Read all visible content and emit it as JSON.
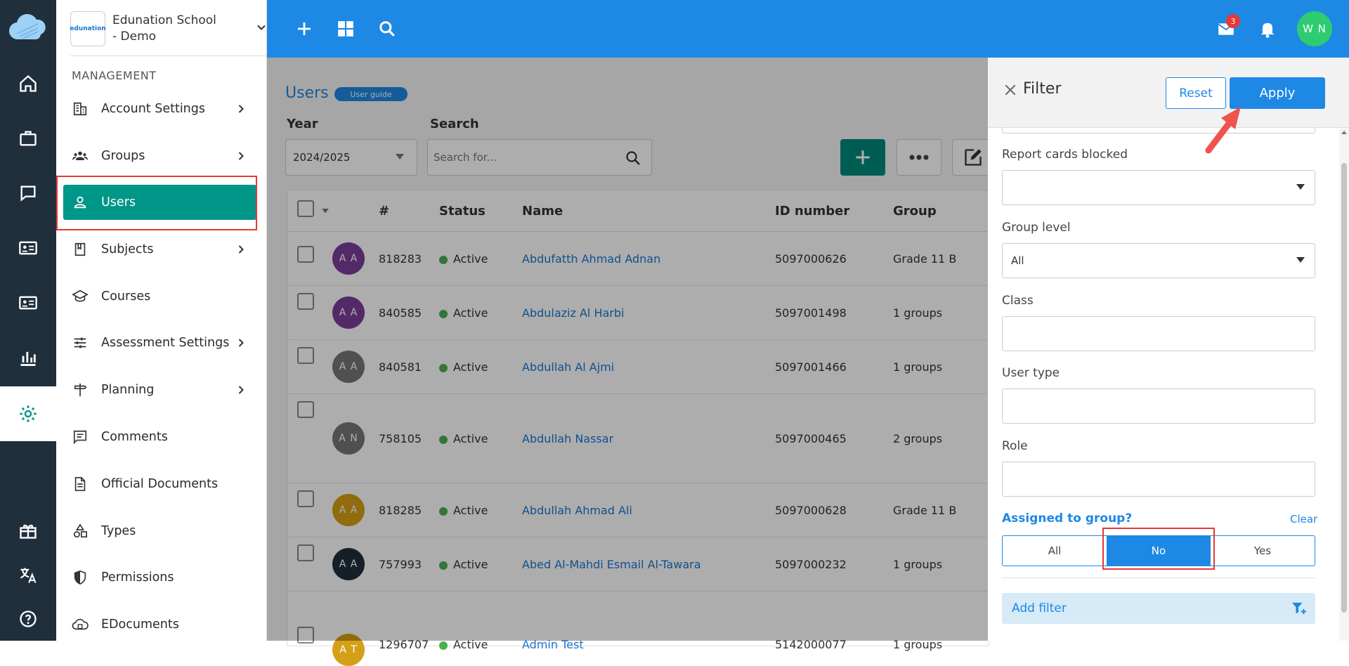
{
  "school": {
    "name": "Edunation School - Demo",
    "logo_text": "edunation"
  },
  "sidebar": {
    "section": "MANAGEMENT",
    "items": [
      {
        "label": "Account Settings"
      },
      {
        "label": "Groups"
      },
      {
        "label": "Users"
      },
      {
        "label": "Subjects"
      },
      {
        "label": "Courses"
      },
      {
        "label": "Assessment Settings"
      },
      {
        "label": "Planning"
      },
      {
        "label": "Comments"
      },
      {
        "label": "Official Documents"
      },
      {
        "label": "Types"
      },
      {
        "label": "Permissions"
      },
      {
        "label": "EDocuments"
      }
    ]
  },
  "topbar": {
    "mail_badge": "3",
    "user_initials": "W N"
  },
  "main": {
    "title": "Users",
    "guide": "User guide",
    "year_label": "Year",
    "year_value": "2024/2025",
    "search_label": "Search",
    "search_placeholder": "Search for..."
  },
  "table": {
    "headers": {
      "num": "#",
      "status": "Status",
      "name": "Name",
      "id": "ID number",
      "group": "Group"
    },
    "rows": [
      {
        "initials": "A A",
        "num": "818283",
        "status": "Active",
        "name": "Abdufatth Ahmad Adnan",
        "id": "5097000626",
        "group": "Grade 11 B",
        "color": "#7b3f98"
      },
      {
        "initials": "A A",
        "num": "840585",
        "status": "Active",
        "name": "Abdulaziz Al Harbi",
        "id": "5097001498",
        "group": "1 groups",
        "color": "#7b3f98"
      },
      {
        "initials": "A A",
        "num": "840581",
        "status": "Active",
        "name": "Abdullah Al Ajmi",
        "id": "5097001466",
        "group": "1 groups",
        "color": "#777"
      },
      {
        "initials": "A N",
        "num": "758105",
        "status": "Active",
        "name": "Abdullah Nassar",
        "id": "5097000465",
        "group": "2 groups",
        "color": "#777"
      },
      {
        "initials": "A A",
        "num": "818285",
        "status": "Active",
        "name": "Abdullah Ahmad Ali",
        "id": "5097000628",
        "group": "Grade 11 B",
        "color": "#d4a017"
      },
      {
        "initials": "A A",
        "num": "757993",
        "status": "Active",
        "name": "Abed Al-Mahdi Esmail Al-Tawara",
        "id": "5097000232",
        "group": "1 groups",
        "color": "#1f2f3c"
      },
      {
        "initials": "A T",
        "num": "1296707",
        "status": "Active",
        "name": "Admin Test",
        "id": "5142000077",
        "group": "1 groups",
        "color": "#d4a017"
      }
    ]
  },
  "filter": {
    "title": "Filter",
    "reset": "Reset",
    "apply": "Apply",
    "report_cards_label": "Report cards blocked",
    "report_cards_value": "",
    "group_level_label": "Group level",
    "group_level_value": "All",
    "class_label": "Class",
    "user_type_label": "User type",
    "role_label": "Role",
    "assigned_label": "Assigned to group?",
    "clear": "Clear",
    "options": [
      "All",
      "No",
      "Yes"
    ],
    "selected": "No",
    "add_filter": "Add filter"
  }
}
